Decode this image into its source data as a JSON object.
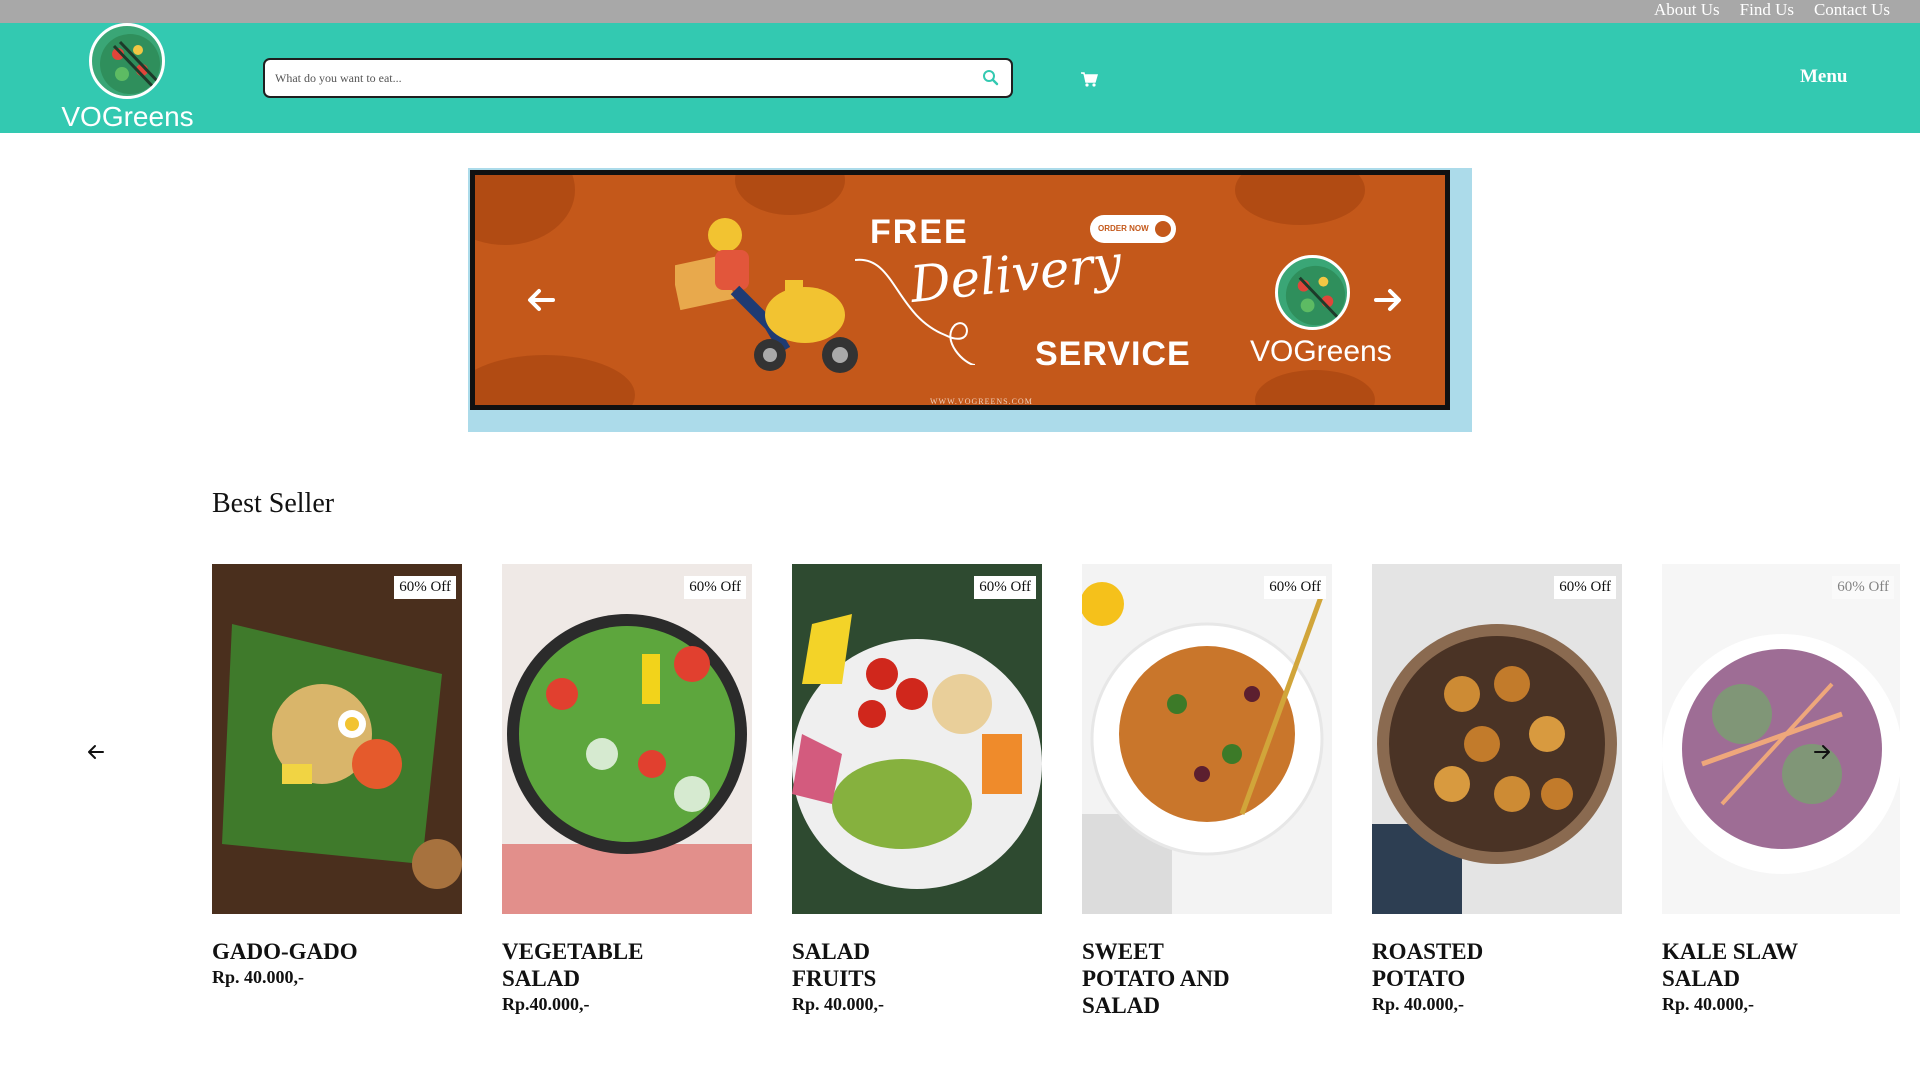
{
  "topbar": {
    "links": [
      "About Us",
      "Find Us",
      "Contact Us"
    ]
  },
  "header": {
    "logo_text": "VOGreens",
    "search_placeholder": "What do you want to eat...",
    "menu_label": "Menu",
    "colors": {
      "header_bg": "#33c9b1",
      "topbar_bg": "#a8a8a8"
    }
  },
  "banner": {
    "free": "FREE",
    "delivery": "Delivery",
    "service": "SERVICE",
    "order_now": "ORDER NOW",
    "logo_text": "VOGreens",
    "url": "WWW.VOGREENS.COM",
    "colors": {
      "bg": "#c4581a",
      "shadow": "#acdbea"
    }
  },
  "best_seller": {
    "title": "Best Seller",
    "items": [
      {
        "name": "GADO-GADO",
        "price": "Rp. 40.000,-",
        "badge": "60% Off"
      },
      {
        "name": "VEGETABLE SALAD",
        "price": "Rp.40.000,-",
        "badge": "60% Off"
      },
      {
        "name": "SALAD FRUITS",
        "price": "Rp. 40.000,-",
        "badge": "60% Off"
      },
      {
        "name": "SWEET POTATO AND SALAD",
        "price": "",
        "badge": "60% Off"
      },
      {
        "name": "ROASTED POTATO",
        "price": "Rp. 40.000,-",
        "badge": "60% Off"
      },
      {
        "name": "KALE SLAW SALAD",
        "price": "Rp. 40.000,-",
        "badge": "60% Off"
      }
    ]
  }
}
